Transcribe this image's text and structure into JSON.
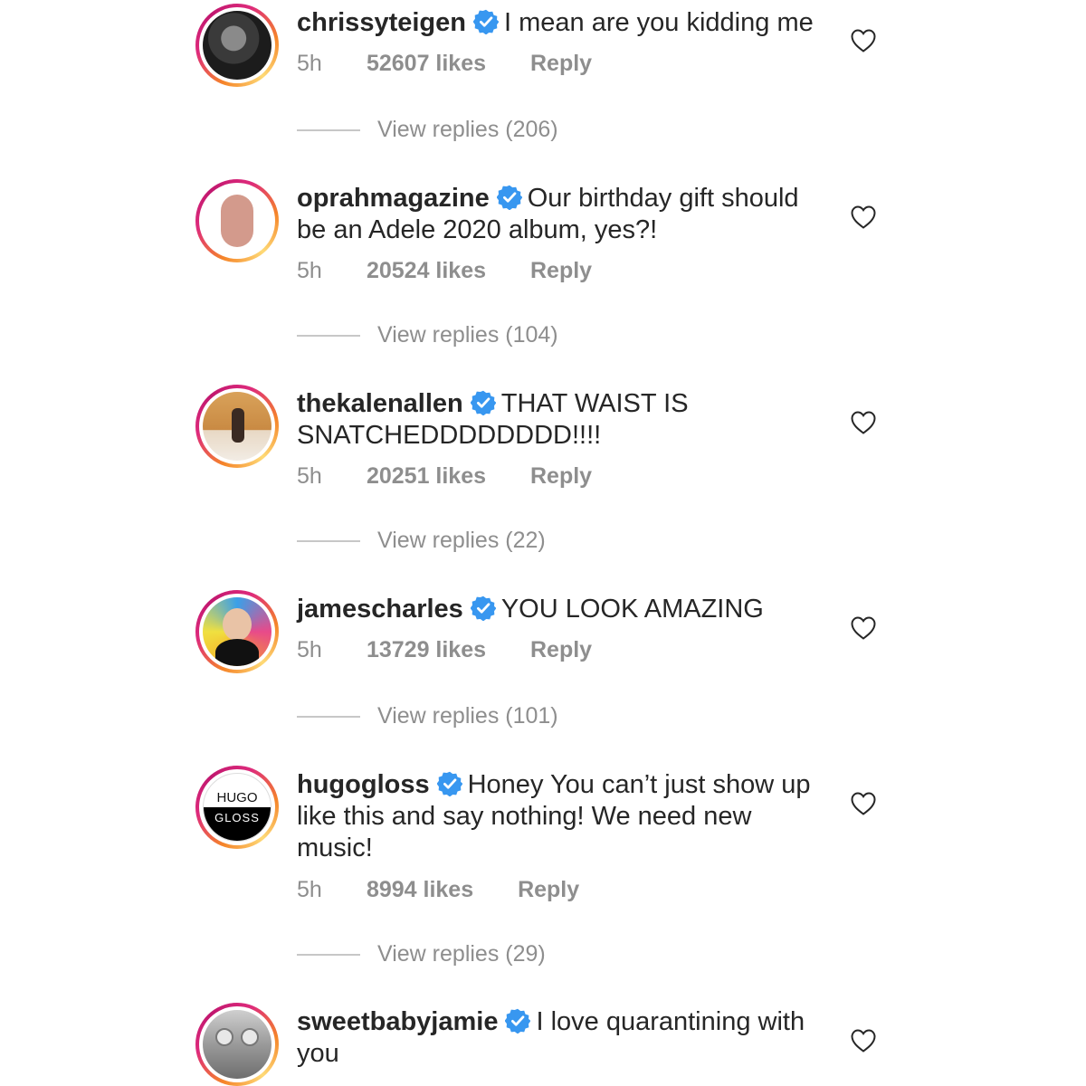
{
  "comments": [
    {
      "username": "chrissyteigen",
      "text": "I mean are you kidding me",
      "time": "5h",
      "likes": "52607 likes",
      "reply": "Reply",
      "view_replies": "View replies (206)"
    },
    {
      "username": "oprahmagazine",
      "text": "Our birthday gift should be an Adele 2020 album, yes?!",
      "time": "5h",
      "likes": "20524 likes",
      "reply": "Reply",
      "view_replies": "View replies (104)"
    },
    {
      "username": "thekalenallen",
      "text": "THAT WAIST IS SNATCHEDDDDDDDD!!!!",
      "time": "5h",
      "likes": "20251 likes",
      "reply": "Reply",
      "view_replies": "View replies (22)"
    },
    {
      "username": "jamescharles",
      "text": "YOU LOOK AMAZING",
      "time": "5h",
      "likes": "13729 likes",
      "reply": "Reply",
      "view_replies": "View replies (101)"
    },
    {
      "username": "hugogloss",
      "text": "Honey You can’t just show up like this and say nothing! We need new music!",
      "time": "5h",
      "likes": "8994 likes",
      "reply": "Reply",
      "view_replies": "View replies (29)",
      "avatar_logo_top": "HUGO",
      "avatar_logo_bottom": "GLOSS"
    },
    {
      "username": "sweetbabyjamie",
      "text": "I love quarantining with you"
    }
  ],
  "colors": {
    "verified": "#3897f0",
    "muted": "#8e8e8e",
    "text": "#262626"
  },
  "icons": {
    "verified": "verified-badge-icon",
    "like": "heart-outline-icon"
  }
}
